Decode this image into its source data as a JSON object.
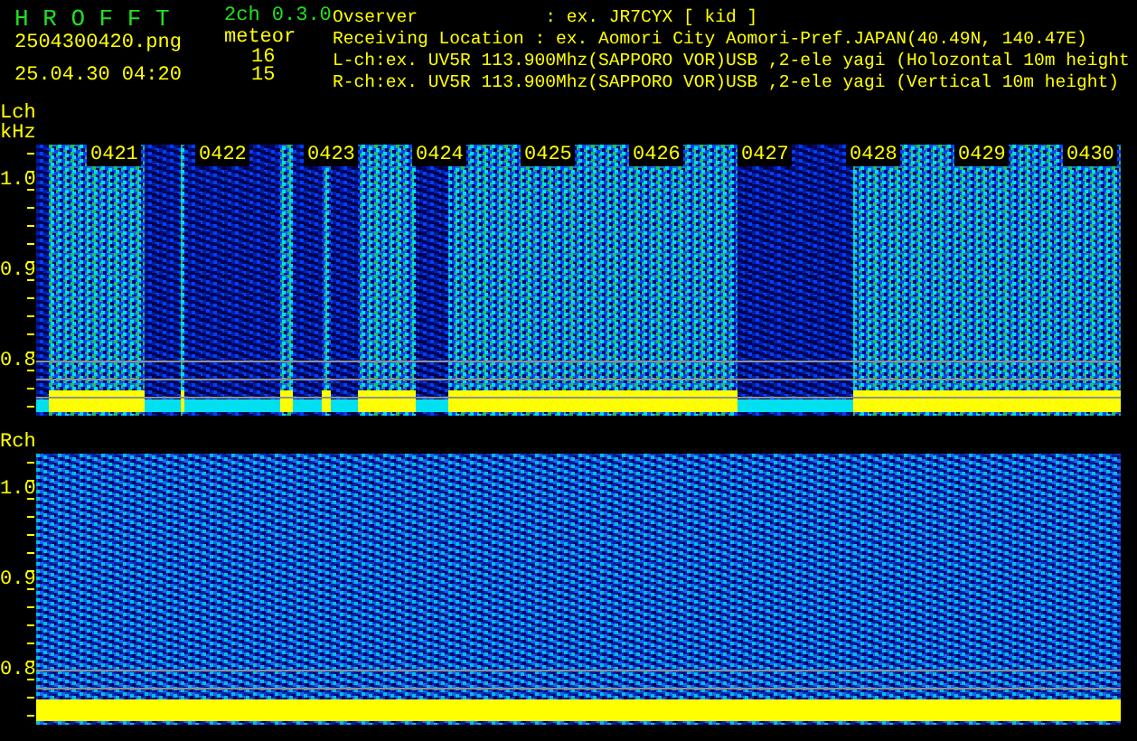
{
  "header": {
    "app_name": "H R O F F T",
    "version": "2ch 0.3.0",
    "filename": "2504300420.png",
    "timestamp": "25.04.30 04:20",
    "count_label": "meteor",
    "counts": [
      "16",
      "15"
    ],
    "info_lines": [
      "Ovserver            : ex. JR7CYX [ kid ]",
      "Receiving Location : ex. Aomori City Aomori-Pref.JAPAN(40.49N, 140.47E)",
      "L-ch:ex. UV5R 113.900Mhz(SAPPORO VOR)USB ,2-ele yagi (Holozontal 10m height",
      "R-ch:ex. UV5R 113.900Mhz(SAPPORO VOR)USB ,2-ele yagi (Vertical 10m height)"
    ]
  },
  "panels": [
    {
      "label": "Lch",
      "unit": "kHz",
      "time_labels": [
        "0421",
        "0422",
        "0423",
        "0424",
        "0425",
        "0426",
        "0427",
        "0428",
        "0429",
        "0430"
      ],
      "freq_ticks": [
        "1.0",
        "0.9",
        "0.8"
      ]
    },
    {
      "label": "Rch",
      "freq_ticks": [
        "1.0",
        "0.9",
        "0.8"
      ]
    }
  ]
}
